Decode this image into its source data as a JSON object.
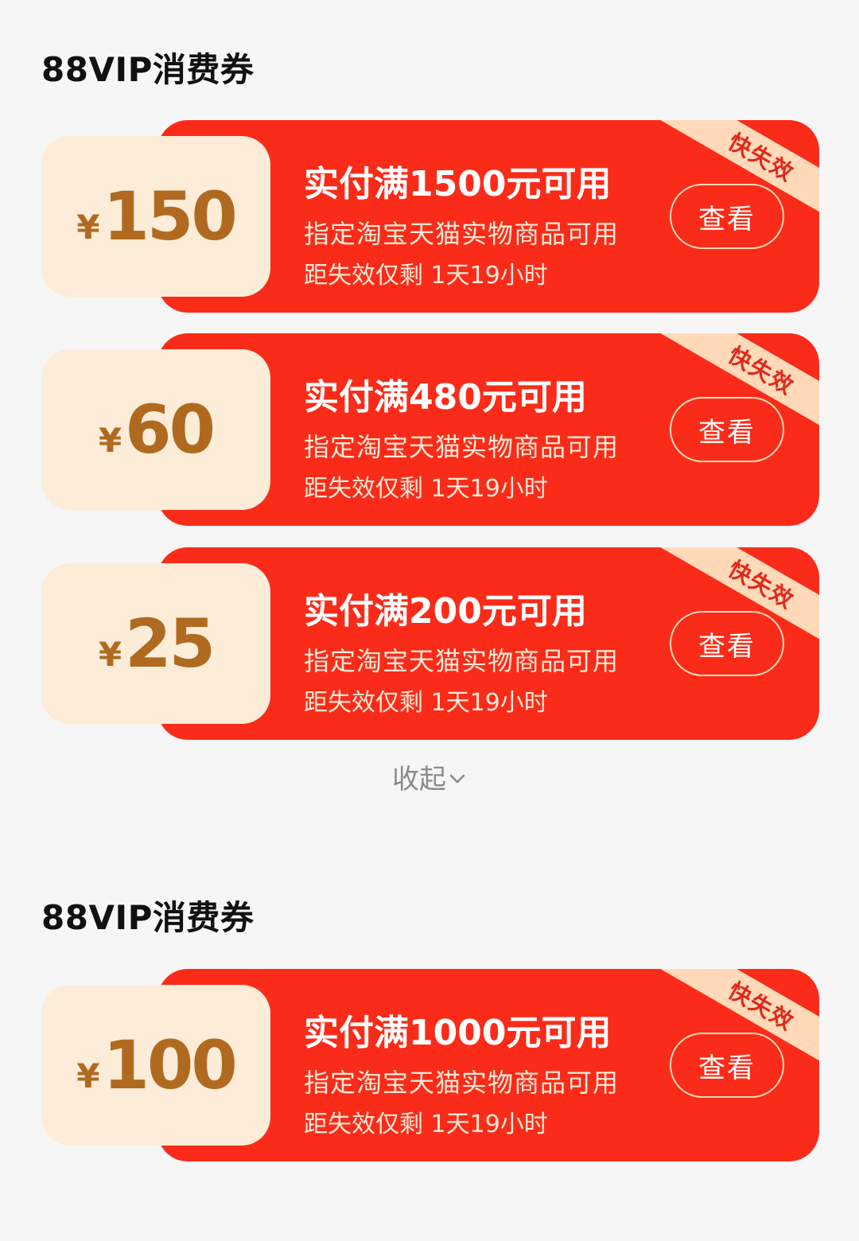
{
  "sections": [
    {
      "title": "88VIP消费券",
      "coupons": [
        {
          "currency": "¥",
          "amount": "150",
          "condition": "实付满1500元可用",
          "scope": "指定淘宝天猫实物商品可用",
          "expire": "距失效仅剩 1天19小时",
          "button": "查看",
          "tag": "快失效"
        },
        {
          "currency": "¥",
          "amount": "60",
          "condition": "实付满480元可用",
          "scope": "指定淘宝天猫实物商品可用",
          "expire": "距失效仅剩 1天19小时",
          "button": "查看",
          "tag": "快失效"
        },
        {
          "currency": "¥",
          "amount": "25",
          "condition": "实付满200元可用",
          "scope": "指定淘宝天猫实物商品可用",
          "expire": "距失效仅剩 1天19小时",
          "button": "查看",
          "tag": "快失效"
        }
      ],
      "collapse_label": "收起"
    },
    {
      "title": "88VIP消费券",
      "coupons": [
        {
          "currency": "¥",
          "amount": "100",
          "condition": "实付满1000元可用",
          "scope": "指定淘宝天猫实物商品可用",
          "expire": "距失效仅剩 1天19小时",
          "button": "查看",
          "tag": "快失效"
        }
      ]
    }
  ],
  "icons": {
    "collapse": "chevron-down-icon"
  },
  "colors": {
    "coupon_red": "#fa2c19",
    "amount_bg": "#fdecd7",
    "amount_text": "#b06a20",
    "tag_bg": "#ffd9b8"
  }
}
